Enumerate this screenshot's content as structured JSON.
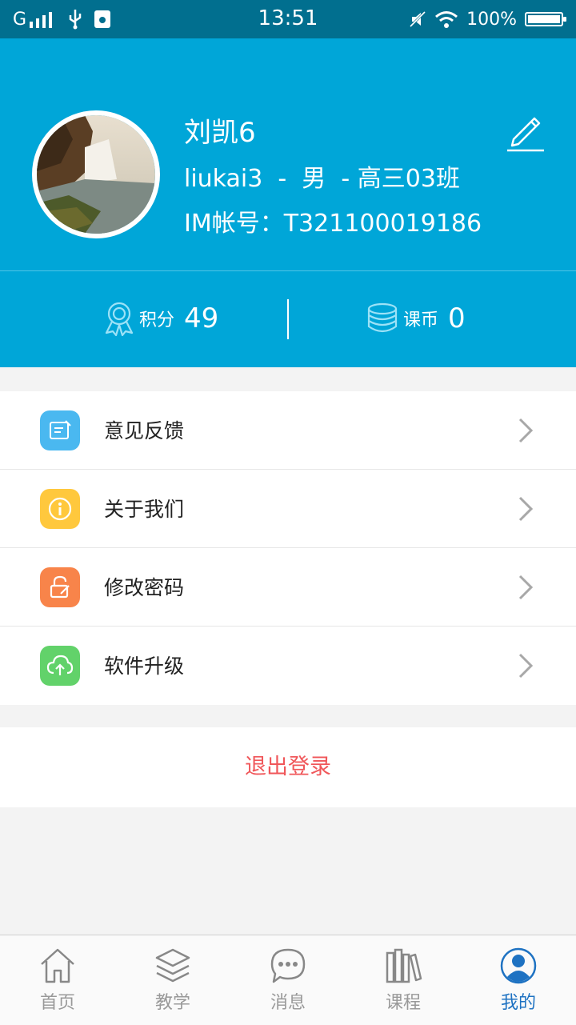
{
  "status_bar": {
    "network": "G",
    "time": "13:51",
    "battery_text": "100%",
    "battery_level": 1.0
  },
  "profile": {
    "name": "刘凯6",
    "info_line": "liukai3  -  男  - 高三03班",
    "im_line": "IM帐号：T321100019186",
    "edit_icon": "pencil-icon"
  },
  "stats": {
    "points_label": "积分",
    "points_value": "49",
    "coins_label": "课币",
    "coins_value": "0"
  },
  "menu": {
    "items": [
      {
        "label": "意见反馈",
        "icon": "feedback-icon",
        "color": "#4ab8f0"
      },
      {
        "label": "关于我们",
        "icon": "info-icon",
        "color": "#ffc83d"
      },
      {
        "label": "修改密码",
        "icon": "lock-edit-icon",
        "color": "#f8844a"
      },
      {
        "label": "软件升级",
        "icon": "cloud-upload-icon",
        "color": "#62d26a"
      }
    ]
  },
  "logout_label": "退出登录",
  "tabs": [
    {
      "label": "首页",
      "icon": "home-icon",
      "active": false
    },
    {
      "label": "教学",
      "icon": "layers-icon",
      "active": false
    },
    {
      "label": "消息",
      "icon": "chat-icon",
      "active": false
    },
    {
      "label": "课程",
      "icon": "books-icon",
      "active": false
    },
    {
      "label": "我的",
      "icon": "user-icon",
      "active": true
    }
  ],
  "colors": {
    "header": "#00a6d8",
    "status_bar": "#016f8f",
    "active_tab": "#1e72c2",
    "logout": "#f0575a"
  }
}
